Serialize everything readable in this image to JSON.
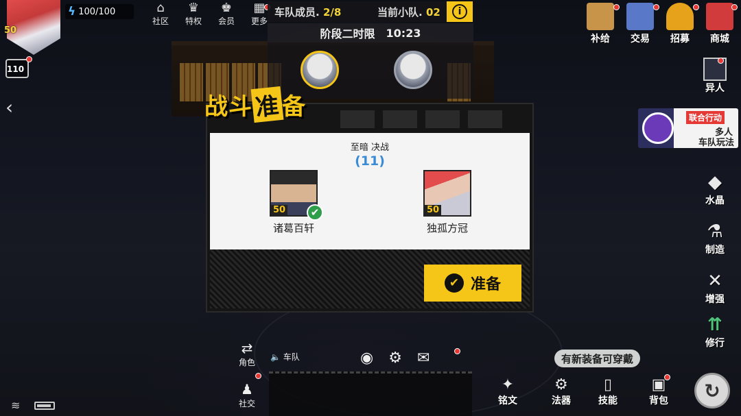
{
  "player": {
    "level": "50",
    "energy": "100/100",
    "stamina": "110"
  },
  "top_nav": [
    {
      "icon": "home-icon",
      "glyph": "⌂",
      "label": "社区"
    },
    {
      "icon": "privilege-icon",
      "glyph": "♛",
      "label": "特权"
    },
    {
      "icon": "member-icon",
      "glyph": "♚",
      "label": "会员"
    },
    {
      "icon": "more-icon",
      "glyph": "▦",
      "label": "更多"
    }
  ],
  "team": {
    "members_label": "车队成员.",
    "members_value": "2/8",
    "squad_label": "当前小队.",
    "squad_value": "02",
    "phase_label": "阶段二时限",
    "phase_time": "10:23"
  },
  "right_top": [
    {
      "icon": "supply-box-icon",
      "label": "补给",
      "color": "#c8944a"
    },
    {
      "icon": "trade-icon",
      "label": "交易",
      "color": "#5a78c8"
    },
    {
      "icon": "recruit-helmet-icon",
      "label": "招募",
      "color": "#e6a21a"
    },
    {
      "icon": "shop-basket-icon",
      "label": "商城",
      "color": "#d23b3b"
    }
  ],
  "side": {
    "yiren": "异人",
    "coop_tag": "联合行动",
    "coop_line1": "多人",
    "coop_line2": "车队玩法",
    "crystal": "水晶",
    "craft": "制造",
    "enhance": "增强",
    "cultivate": "修行"
  },
  "dialog": {
    "title_a": "战斗",
    "title_b": "准",
    "title_c": "备",
    "mode": "至暗  决战",
    "countdown": "(11)",
    "players": [
      {
        "name": "诸葛百轩",
        "level": "50",
        "ready": "✔"
      },
      {
        "name": "独孤方冠",
        "level": "50"
      }
    ],
    "ready_label": "准备"
  },
  "bottom": {
    "role": "角色",
    "team_voice": "车队",
    "social": "社交",
    "tooltip": "有新装备可穿戴",
    "right": [
      {
        "icon": "inscription-icon",
        "glyph": "✦",
        "label": "铭文"
      },
      {
        "icon": "artifact-icon",
        "glyph": "⚙",
        "label": "法器"
      },
      {
        "icon": "skill-book-icon",
        "glyph": "▯",
        "label": "技能"
      },
      {
        "icon": "backpack-icon",
        "glyph": "▣",
        "label": "背包"
      }
    ]
  },
  "colors": {
    "accent": "#f5c518",
    "countdown": "#3a8bd6",
    "ready_check": "#2e9e4a"
  }
}
